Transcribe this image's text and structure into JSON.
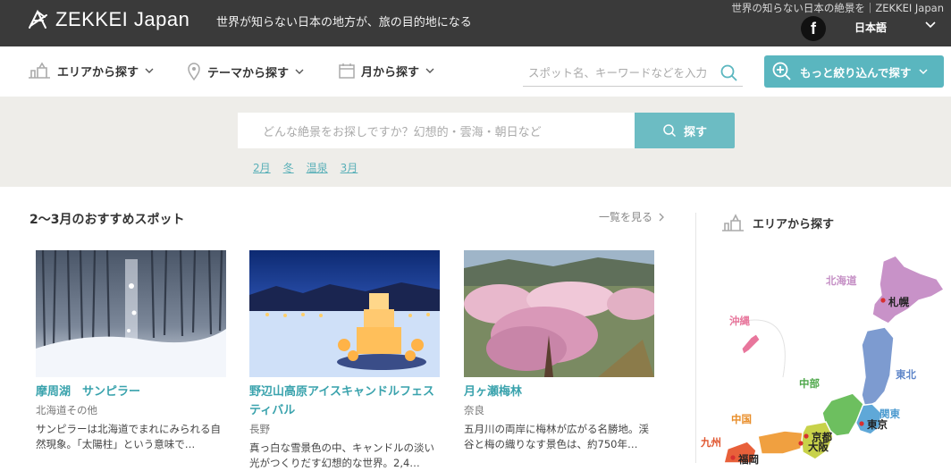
{
  "header": {
    "logo_text": "ZEKKEI Japan",
    "tagline": "世界が知らない日本の地方が、旅の目的地になる",
    "top_right": "世界の知らない日本の絶景を｜ZEKKEI Japan",
    "facebook_glyph": "f",
    "language": "日本語"
  },
  "nav": {
    "area": "エリアから探す",
    "theme": "テーマから探す",
    "month": "月から探す",
    "search_placeholder": "スポット名、キーワードなどを入力",
    "narrow_button": "もっと絞り込んで探す"
  },
  "main_search": {
    "placeholder": "どんな絶景をお探しですか？幻想的・雲海・朝日など",
    "button": "探す",
    "tags": [
      "2月",
      "冬",
      "温泉",
      "3月"
    ]
  },
  "section": {
    "title": "2～3月のおすすめスポット",
    "see_all": "一覧を見る"
  },
  "cards": [
    {
      "title": "摩周湖　サンピラー",
      "pref": "北海道その他",
      "desc": "サンピラーは北海道でまれにみられる自然現象。「太陽柱」という意味で…"
    },
    {
      "title": "野辺山高原アイスキャンドルフェスティバル",
      "pref": "長野",
      "desc": "真っ白な雪景色の中、キャンドルの淡い光がつくりだす幻想的な世界。2,4…"
    },
    {
      "title": "月ヶ瀬梅林",
      "pref": "奈良",
      "desc": "五月川の両岸に梅林が広がる名勝地。渓谷と梅の織りなす景色は、約750年…"
    }
  ],
  "area_panel": {
    "title": "エリアから探す",
    "regions": {
      "hokkaido": "北海道",
      "okinawa": "沖縄",
      "tohoku": "東北",
      "kanto": "関東",
      "chubu": "中部",
      "chugoku": "中国",
      "kyushu": "九州"
    },
    "cities": {
      "sapporo": "札幌",
      "tokyo": "東京",
      "kyoto": "京都",
      "osaka": "大阪",
      "fukuoka": "福岡"
    }
  },
  "colors": {
    "teal": "#5ab6bf",
    "hokkaido": "#c892c8",
    "tohoku": "#7d9bd0",
    "kanto": "#5fa8d8",
    "chubu": "#6dbf5f",
    "kinki": "#c8d24a",
    "chugoku": "#f0a040",
    "kyushu": "#e8603a",
    "okinawa": "#e8769c"
  }
}
